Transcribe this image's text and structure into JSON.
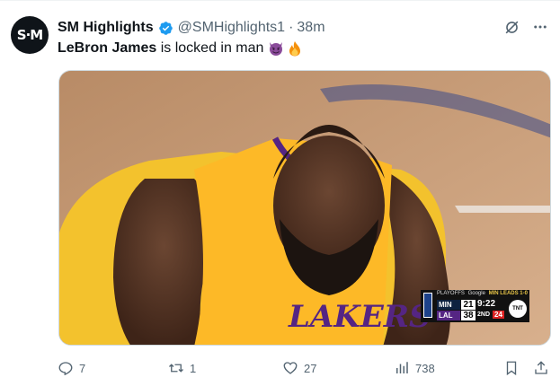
{
  "tweet": {
    "avatar_text": "S·M",
    "author_name": "SM Highlights",
    "handle": "@SMHighlights1",
    "separator": "·",
    "time": "38m",
    "text_bold": "LeBron James",
    "text_rest": " is locked in man",
    "emojis": [
      "smiling-imp-emoji",
      "fire-emoji"
    ]
  },
  "media": {
    "jersey_text": "LAKERS",
    "scorebug": {
      "header_left": "PLAYOFFS",
      "header_mid": "Google",
      "header_lead": "MIN LEADS 1-0",
      "team1": "MIN",
      "score1": "21",
      "team2": "LAL",
      "score2": "38",
      "clock": "9:22",
      "quarter": "2ND",
      "shot_clock": "24",
      "network": "TNT"
    }
  },
  "actions": {
    "replies": "7",
    "reposts": "1",
    "likes": "27",
    "views": "738"
  },
  "colors": {
    "accent_verified": "#1d9bf0",
    "secondary_text": "#536471",
    "lakers_gold": "#fdb927",
    "lakers_purple": "#552583"
  }
}
